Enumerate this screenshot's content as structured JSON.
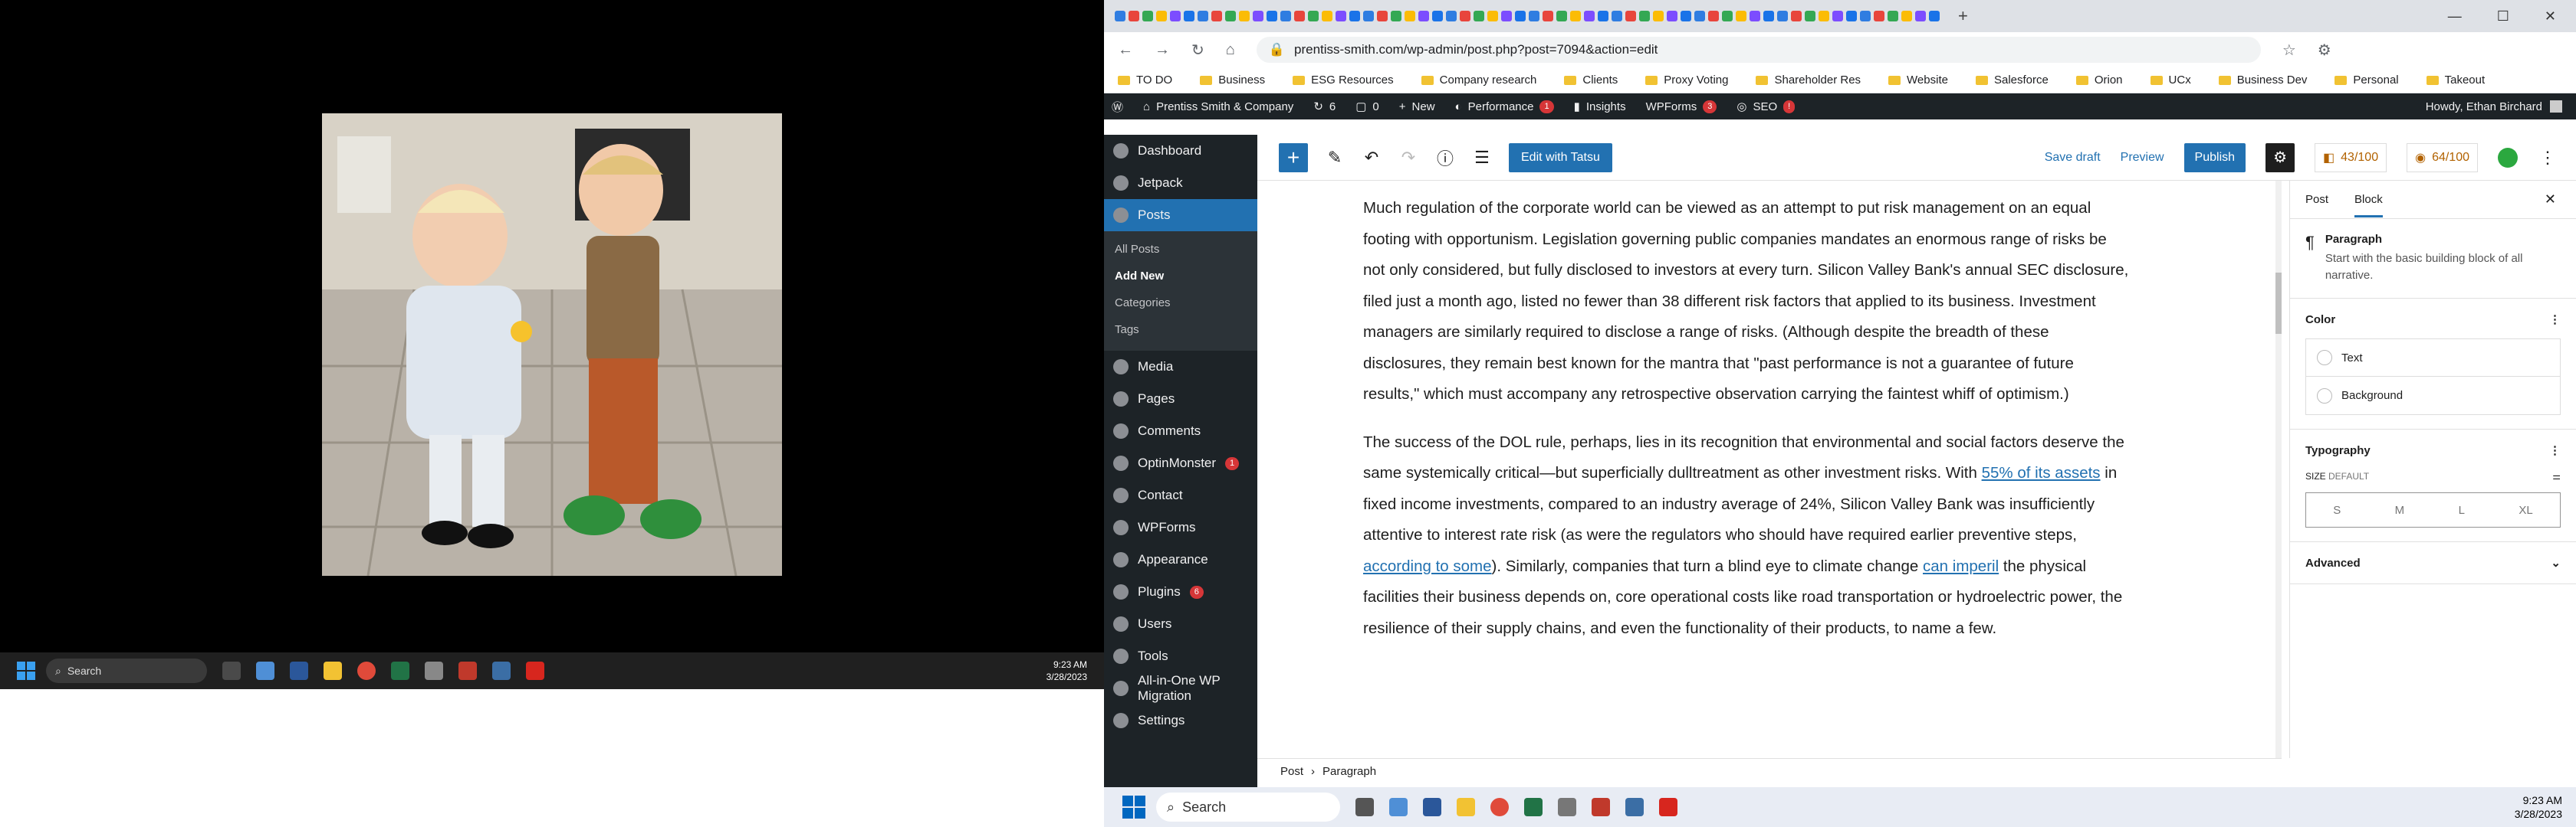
{
  "left_taskbar": {
    "search": "Search",
    "time": "9:23 AM",
    "date": "3/28/2023"
  },
  "browser": {
    "url": "prentiss-smith.com/wp-admin/post.php?post=7094&action=edit",
    "bookmarks": [
      "TO DO",
      "Business",
      "ESG Resources",
      "Company research",
      "Clients",
      "Proxy Voting",
      "Shareholder Res",
      "Website",
      "Salesforce",
      "Orion",
      "UCx",
      "Business Dev",
      "Personal",
      "Takeout"
    ]
  },
  "wp_admin_bar": {
    "site": "Prentiss Smith & Company",
    "updates": "6",
    "comments": "0",
    "new": "New",
    "performance": "Performance",
    "performance_badge": "1",
    "insights": "Insights",
    "wpforms": "WPForms",
    "wpforms_badge": "3",
    "seo": "SEO",
    "seo_badge": "!",
    "howdy": "Howdy, Ethan Birchard"
  },
  "sidebar": {
    "items": [
      {
        "label": "Dashboard"
      },
      {
        "label": "Jetpack"
      },
      {
        "label": "Posts"
      },
      {
        "label": "Media"
      },
      {
        "label": "Pages"
      },
      {
        "label": "Comments"
      },
      {
        "label": "OptinMonster",
        "badge": "1"
      },
      {
        "label": "Contact"
      },
      {
        "label": "WPForms"
      },
      {
        "label": "Appearance"
      },
      {
        "label": "Plugins",
        "badge": "6"
      },
      {
        "label": "Users"
      },
      {
        "label": "Tools"
      },
      {
        "label": "All-in-One WP Migration"
      },
      {
        "label": "Settings"
      }
    ],
    "posts_sub": [
      "All Posts",
      "Add New",
      "Categories",
      "Tags"
    ]
  },
  "editor_toolbar": {
    "tatsu": "Edit with Tatsu",
    "save_draft": "Save draft",
    "preview": "Preview",
    "publish": "Publish",
    "score1": "43/100",
    "score2": "64/100"
  },
  "content": {
    "p1": "Much regulation of the corporate world can be viewed as an attempt to put risk management on an equal footing with opportunism. Legislation governing public companies mandates an enormous range of risks be not only considered, but fully disclosed to investors at every turn. Silicon Valley Bank's annual SEC disclosure, filed just a month ago, listed no fewer than 38 different risk factors that applied to its business. Investment managers are similarly required to disclose a range of risks. (Although despite the breadth of these disclosures, they remain best known for the mantra that \"past performance is not a guarantee of future results,\" which must accompany any retrospective observation carrying the faintest whiff of optimism.)",
    "p2a": "The success of the DOL rule, perhaps, lies in its recognition that environmental and social factors deserve the same systemically critical—but superficially dulltreatment as other investment risks. With ",
    "p2_link1": "55% of its assets",
    "p2b": " in fixed income investments, compared to an industry average of 24%, Silicon Valley Bank was insufficiently attentive to interest rate risk (as were the regulators who should have required earlier preventive steps, ",
    "p2_link2": "according to some",
    "p2c": "). Similarly, companies that turn a blind eye to climate change ",
    "p2_link3": "can imperil",
    "p2d": " the physical facilities their business depends on, core operational costs like road transportation or hydroelectric power, the resilience of their supply chains, and even the functionality of their products, to name a few."
  },
  "breadcrumb": [
    "Post",
    "Paragraph"
  ],
  "panel": {
    "tab_post": "Post",
    "tab_block": "Block",
    "block_name": "Paragraph",
    "block_desc": "Start with the basic building block of all narrative.",
    "color": "Color",
    "text": "Text",
    "background": "Background",
    "typography": "Typography",
    "size_label": "SIZE",
    "size_value": "DEFAULT",
    "sizes": [
      "S",
      "M",
      "L",
      "XL"
    ],
    "advanced": "Advanced"
  },
  "right_taskbar": {
    "search": "Search",
    "time": "9:23 AM",
    "date": "3/28/2023"
  }
}
